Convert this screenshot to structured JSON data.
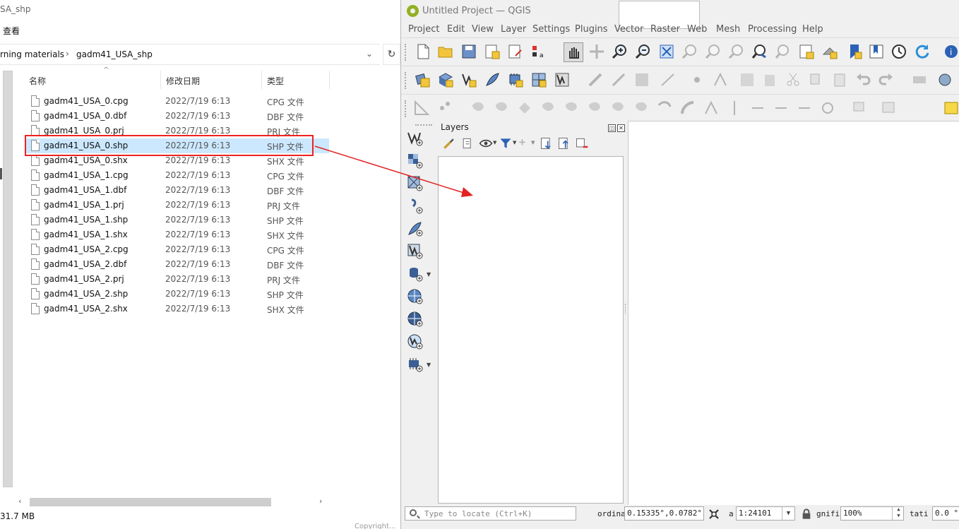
{
  "explorer": {
    "title": "SA_shp",
    "menu_view": "查看",
    "breadcrumb": [
      "rning materials",
      "gadm41_USA_shp"
    ],
    "columns": {
      "name": "名称",
      "modified": "修改日期",
      "type": "类型"
    },
    "files": [
      {
        "name": "gadm41_USA_0.cpg",
        "date": "2022/7/19 6:13",
        "type": "CPG 文件"
      },
      {
        "name": "gadm41_USA_0.dbf",
        "date": "2022/7/19 6:13",
        "type": "DBF 文件"
      },
      {
        "name": "gadm41_USA_0.prj",
        "date": "2022/7/19 6:13",
        "type": "PRJ 文件"
      },
      {
        "name": "gadm41_USA_0.shp",
        "date": "2022/7/19 6:13",
        "type": "SHP 文件"
      },
      {
        "name": "gadm41_USA_0.shx",
        "date": "2022/7/19 6:13",
        "type": "SHX 文件"
      },
      {
        "name": "gadm41_USA_1.cpg",
        "date": "2022/7/19 6:13",
        "type": "CPG 文件"
      },
      {
        "name": "gadm41_USA_1.dbf",
        "date": "2022/7/19 6:13",
        "type": "DBF 文件"
      },
      {
        "name": "gadm41_USA_1.prj",
        "date": "2022/7/19 6:13",
        "type": "PRJ 文件"
      },
      {
        "name": "gadm41_USA_1.shp",
        "date": "2022/7/19 6:13",
        "type": "SHP 文件"
      },
      {
        "name": "gadm41_USA_1.shx",
        "date": "2022/7/19 6:13",
        "type": "SHX 文件"
      },
      {
        "name": "gadm41_USA_2.cpg",
        "date": "2022/7/19 6:13",
        "type": "CPG 文件"
      },
      {
        "name": "gadm41_USA_2.dbf",
        "date": "2022/7/19 6:13",
        "type": "DBF 文件"
      },
      {
        "name": "gadm41_USA_2.prj",
        "date": "2022/7/19 6:13",
        "type": "PRJ 文件"
      },
      {
        "name": "gadm41_USA_2.shp",
        "date": "2022/7/19 6:13",
        "type": "SHP 文件"
      },
      {
        "name": "gadm41_USA_2.shx",
        "date": "2022/7/19 6:13",
        "type": "SHX 文件"
      }
    ],
    "selected_file": "gadm41_USA_0.shp",
    "status_size": "31.7 MB",
    "highlight_color": "#e22222"
  },
  "qgis": {
    "window_title": "Untitled Project — QGIS",
    "menu": [
      "Project",
      "Edit",
      "View",
      "Layer",
      "Settings",
      "Plugins",
      "Vector",
      "Raster",
      "Web",
      "Mesh",
      "Processing",
      "Help"
    ],
    "layers_panel_title": "Layers",
    "status": {
      "locate_placeholder": "Type to locate (Ctrl+K)",
      "coordinate_label": "ordina",
      "coordinate_value": "0.15335°,0.0782°",
      "scale_label": "a",
      "scale_value": "1:24101",
      "magnifier_label": "gnifi",
      "magnifier_value": "100%",
      "rotation_label": "tati",
      "rotation_value": "0.0 °"
    },
    "brand_color": "#93b023"
  },
  "footer_text": "Copyright..."
}
